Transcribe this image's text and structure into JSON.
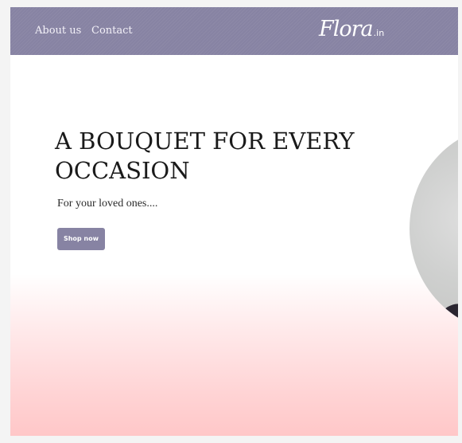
{
  "nav": {
    "links": [
      "About us",
      "Contact"
    ],
    "logo_main": "Flora",
    "logo_suffix": ".in"
  },
  "hero": {
    "title": "A BOUQUET FOR EVERY OCCASION",
    "subtitle": "For your loved ones....",
    "cta_label": "Shop now"
  },
  "colors": {
    "brand": "#8783a3",
    "gradient_bottom": "#ffc7c8",
    "text": "#1a1a1a"
  }
}
